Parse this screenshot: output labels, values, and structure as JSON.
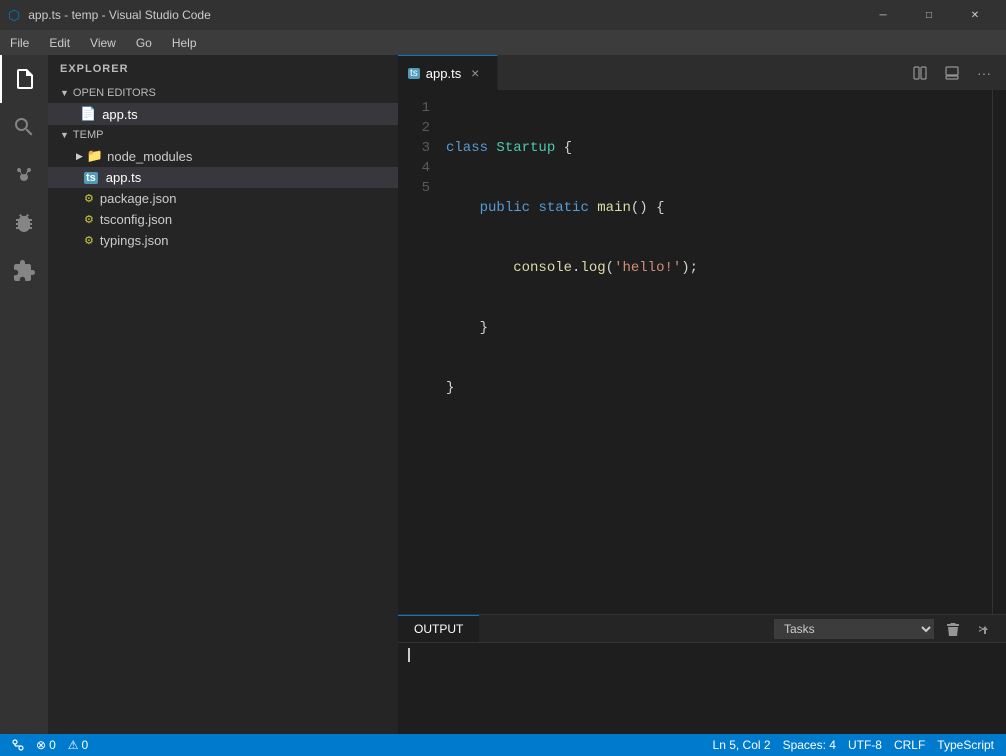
{
  "titlebar": {
    "title": "app.ts - temp - Visual Studio Code",
    "icon": "🔷",
    "minimize": "─",
    "maximize": "□",
    "close": "✕"
  },
  "menubar": {
    "items": [
      "File",
      "Edit",
      "View",
      "Go",
      "Help"
    ]
  },
  "sidebar": {
    "header": "EXPLORER",
    "sections": [
      {
        "label": "OPEN EDITORS",
        "expanded": true,
        "files": [
          "app.ts"
        ]
      },
      {
        "label": "TEMP",
        "expanded": true,
        "folders": [
          "node_modules"
        ],
        "files": [
          "app.ts",
          "package.json",
          "tsconfig.json",
          "typings.json"
        ]
      }
    ]
  },
  "editor": {
    "tab_label": "app.ts",
    "lines": [
      {
        "num": "1",
        "content": "class Startup {"
      },
      {
        "num": "2",
        "content": "    public static main() {"
      },
      {
        "num": "3",
        "content": "        console.log('hello!');"
      },
      {
        "num": "4",
        "content": "    }"
      },
      {
        "num": "5",
        "content": "}"
      }
    ]
  },
  "output": {
    "tab_label": "OUTPUT",
    "tasks_label": "Tasks",
    "content": ""
  },
  "statusbar": {
    "errors": "0",
    "warnings": "0",
    "ln": "Ln 5, Col 2",
    "spaces": "Spaces: 4",
    "encoding": "UTF-8",
    "line_ending": "CRLF",
    "language": "TypeScript"
  },
  "activity": {
    "items": [
      {
        "name": "files-icon",
        "icon": "⎗",
        "active": true
      },
      {
        "name": "search-icon",
        "icon": "⌕",
        "active": false
      },
      {
        "name": "source-control-icon",
        "icon": "⎇",
        "active": false
      },
      {
        "name": "debug-icon",
        "icon": "⬡",
        "active": false
      },
      {
        "name": "extensions-icon",
        "icon": "⊞",
        "active": false
      }
    ]
  }
}
